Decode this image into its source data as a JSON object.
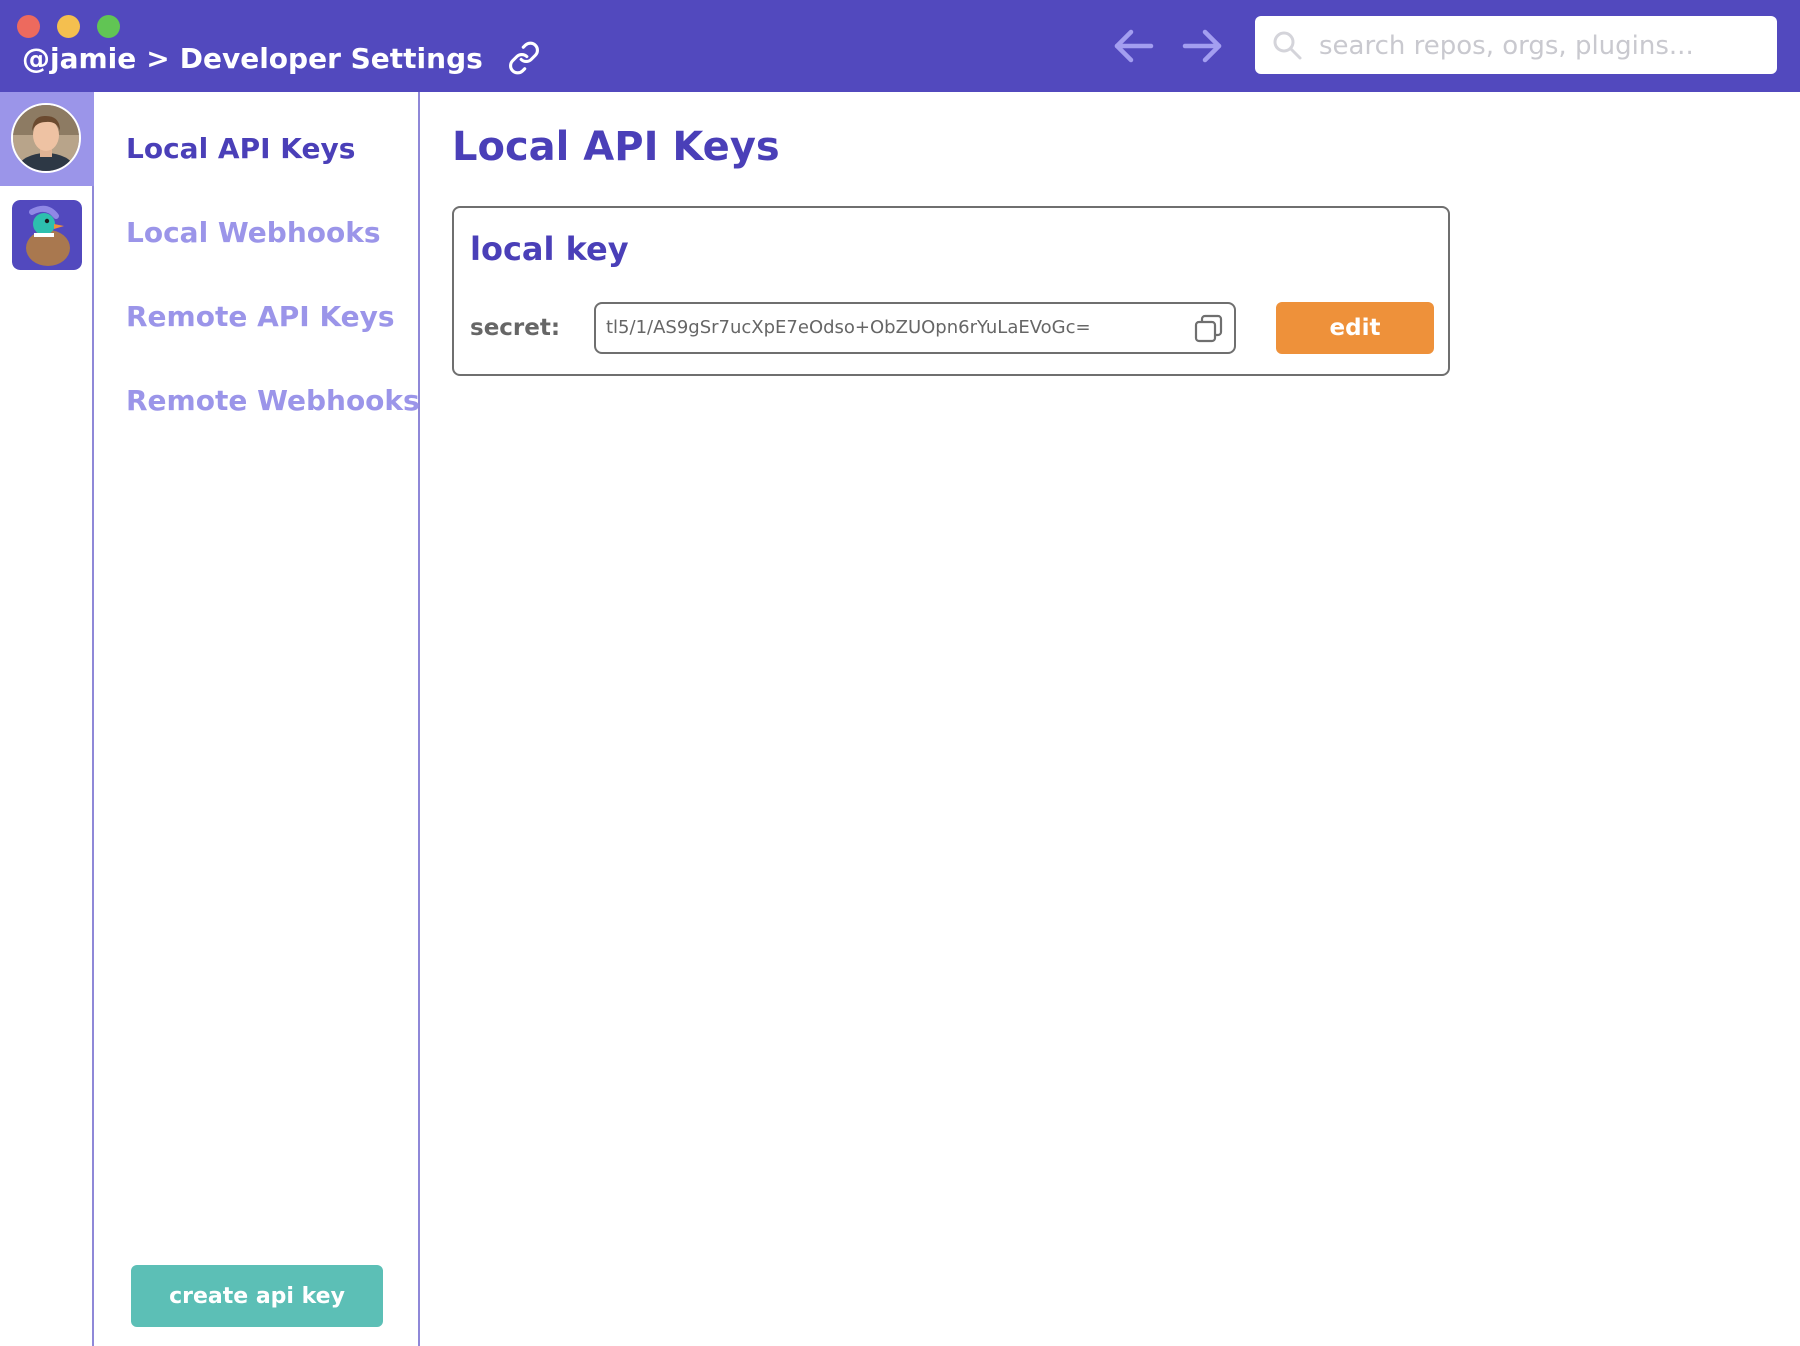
{
  "window": {
    "breadcrumb": {
      "user": "@jamie",
      "separator": ">",
      "page": "Developer Settings"
    },
    "icons": {
      "link": "link-icon",
      "back": "arrow-left-icon",
      "forward": "arrow-right-icon",
      "search": "search-icon"
    },
    "search": {
      "placeholder": "search repos, orgs, plugins..."
    }
  },
  "app_rail": {
    "items": [
      {
        "icon": "user-avatar",
        "active": true
      },
      {
        "icon": "duck-org-logo",
        "active": false
      }
    ]
  },
  "sidebar": {
    "items": [
      {
        "label": "Local API Keys",
        "active": true
      },
      {
        "label": "Local Webhooks",
        "active": false
      },
      {
        "label": "Remote API Keys",
        "active": false
      },
      {
        "label": "Remote Webhooks",
        "active": false
      }
    ],
    "create_button": "create api key"
  },
  "main": {
    "title": "Local API Keys",
    "keys": [
      {
        "name": "local key",
        "secret_label": "secret:",
        "secret_value": "tl5/1/AS9gSr7ucXpE7eOdso+ObZUOpn6rYuLaEVoGc=",
        "copy_icon": "copy-icon",
        "edit_label": "edit"
      }
    ]
  },
  "colors": {
    "titlebar": "#5249be",
    "accent": "#4a3fb8",
    "muted_accent": "#9b95e9",
    "edit_button": "#ee913a",
    "create_button": "#5cbfb6"
  }
}
